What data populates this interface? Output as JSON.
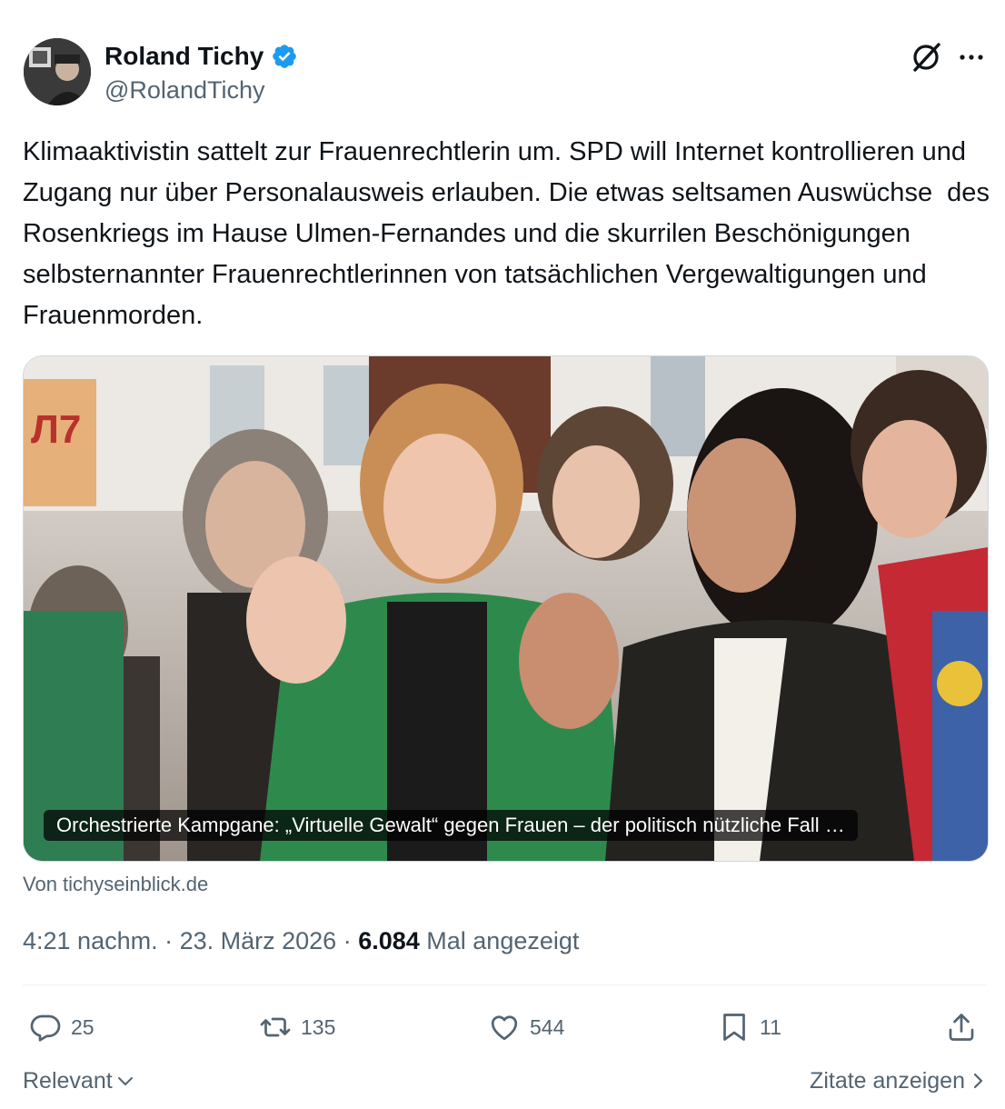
{
  "author": {
    "name": "Roland Tichy",
    "handle": "@RolandTichy",
    "verified_color": "#1d9bf0"
  },
  "tweet": {
    "text": "Klimaaktivistin sattelt zur Frauenrechtlerin um. SPD will Internet kontrollieren und Zugang nur über Personalausweis erlauben. Die etwas seltsamen Auswüchse  des Rosenkriegs im Hause Ulmen-Fernandes und die skurrilen Beschönigungen selbsternannter Frauenrechtlerinnen von tatsächlichen Vergewaltigungen und Frauenmorden."
  },
  "card": {
    "caption": "Orchestrierte Kampgane: „Virtuelle Gewalt“ gegen Frauen – der politisch nützliche Fall …",
    "source": "Von tichyseinblick.de"
  },
  "meta": {
    "time": "4:21 nachm.",
    "sep1": " · ",
    "date": "23. März 2026",
    "sep2": " · ",
    "views": "6.084",
    "views_label": " Mal angezeigt"
  },
  "actions": {
    "replies": "25",
    "retweets": "135",
    "likes": "544",
    "bookmarks": "11"
  },
  "footer": {
    "sort_label": "Relevant",
    "quotes_label": "Zitate anzeigen"
  },
  "icons": [
    "verified-badge-icon",
    "grok-icon",
    "more-icon",
    "reply-icon",
    "retweet-icon",
    "like-icon",
    "bookmark-icon",
    "share-icon",
    "chevron-down-icon",
    "chevron-right-icon"
  ],
  "colors": {
    "text": "#0f1419",
    "muted": "#536471",
    "border": "#cfd9de",
    "accent": "#1d9bf0"
  }
}
